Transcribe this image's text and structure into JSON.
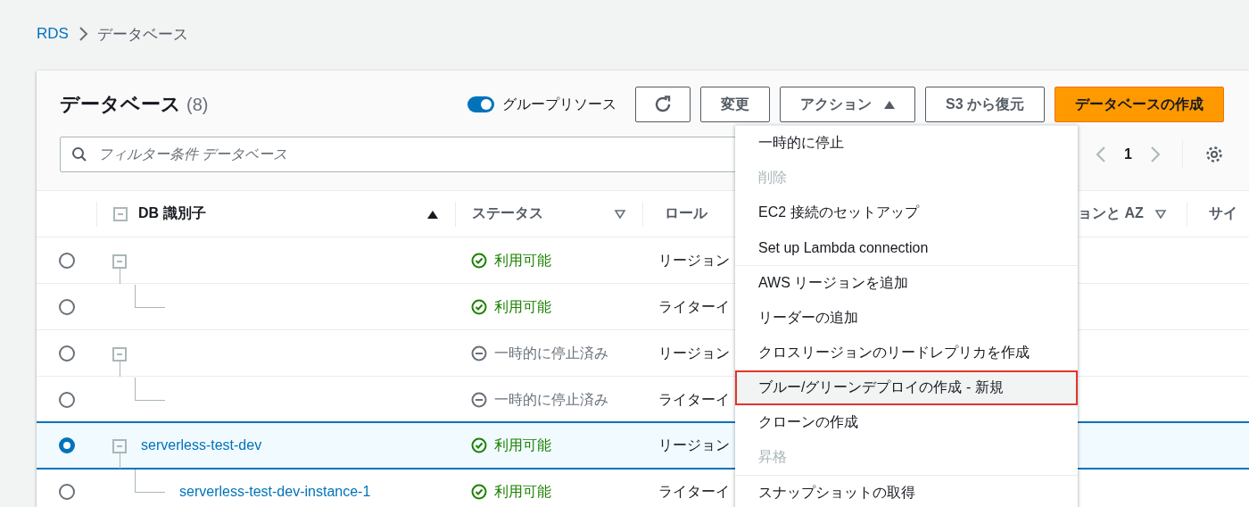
{
  "breadcrumb": [
    {
      "label": "RDS"
    },
    {
      "label": "データベース"
    }
  ],
  "header": {
    "title": "データベース",
    "count": "(8)",
    "toggle": {
      "label": "グループリソース",
      "on": true
    },
    "buttons": [
      {
        "kind": "refresh"
      },
      {
        "kind": "text",
        "label": "変更"
      },
      {
        "kind": "menu",
        "label": "アクション",
        "expanded": true
      },
      {
        "kind": "text",
        "label": "S3 から復元"
      },
      {
        "kind": "primary",
        "label": "データベースの作成"
      }
    ]
  },
  "filter": {
    "placeholder": "フィルター条件 データベース"
  },
  "pagination": {
    "page": "1"
  },
  "table": {
    "columns": [
      {
        "label": "DB 識別子",
        "sort_active": true
      },
      {
        "label": "ステータス",
        "sort_active": false
      },
      {
        "label": "ロール"
      },
      {
        "label": "ョンと AZ",
        "sort_active": false
      },
      {
        "label": "サイ"
      }
    ],
    "rows": [
      {
        "selected": false,
        "status": {
          "kind": "available",
          "text": "利用可能"
        },
        "role": "リージョン",
        "children": [
          {
            "selected": false,
            "status": {
              "kind": "available",
              "text": "利用可能"
            },
            "role": "ライターイ"
          }
        ]
      },
      {
        "selected": false,
        "status": {
          "kind": "stopped",
          "text": "一時的に停止済み"
        },
        "role": "リージョン",
        "children": [
          {
            "selected": false,
            "status": {
              "kind": "stopped",
              "text": "一時的に停止済み"
            },
            "role": "ライターイ"
          }
        ]
      },
      {
        "selected": true,
        "identifier": "serverless-test-dev",
        "status": {
          "kind": "available",
          "text": "利用可能"
        },
        "role": "リージョン",
        "children": [
          {
            "selected": false,
            "identifier": "serverless-test-dev-instance-1",
            "status": {
              "kind": "available",
              "text": "利用可能"
            },
            "role": "ライターイ"
          }
        ]
      }
    ]
  },
  "actions_menu": [
    [
      {
        "label": "一時的に停止",
        "disabled": false,
        "highlighted": false
      },
      {
        "label": "削除",
        "disabled": true,
        "highlighted": false
      },
      {
        "label": "EC2 接続のセットアップ",
        "disabled": false,
        "highlighted": false
      },
      {
        "label": "Set up Lambda connection",
        "disabled": false,
        "highlighted": false
      }
    ],
    [
      {
        "label": "AWS リージョンを追加",
        "disabled": false,
        "highlighted": false
      },
      {
        "label": "リーダーの追加",
        "disabled": false,
        "highlighted": false
      },
      {
        "label": "クロスリージョンのリードレプリカを作成",
        "disabled": false,
        "highlighted": false
      },
      {
        "label": "ブルー/グリーンデプロイの作成 - 新規",
        "disabled": false,
        "highlighted": true
      },
      {
        "label": "クローンの作成",
        "disabled": false,
        "highlighted": false
      },
      {
        "label": "昇格",
        "disabled": true,
        "highlighted": false
      }
    ],
    [
      {
        "label": "スナップショットの取得",
        "disabled": false,
        "highlighted": false
      }
    ]
  ]
}
